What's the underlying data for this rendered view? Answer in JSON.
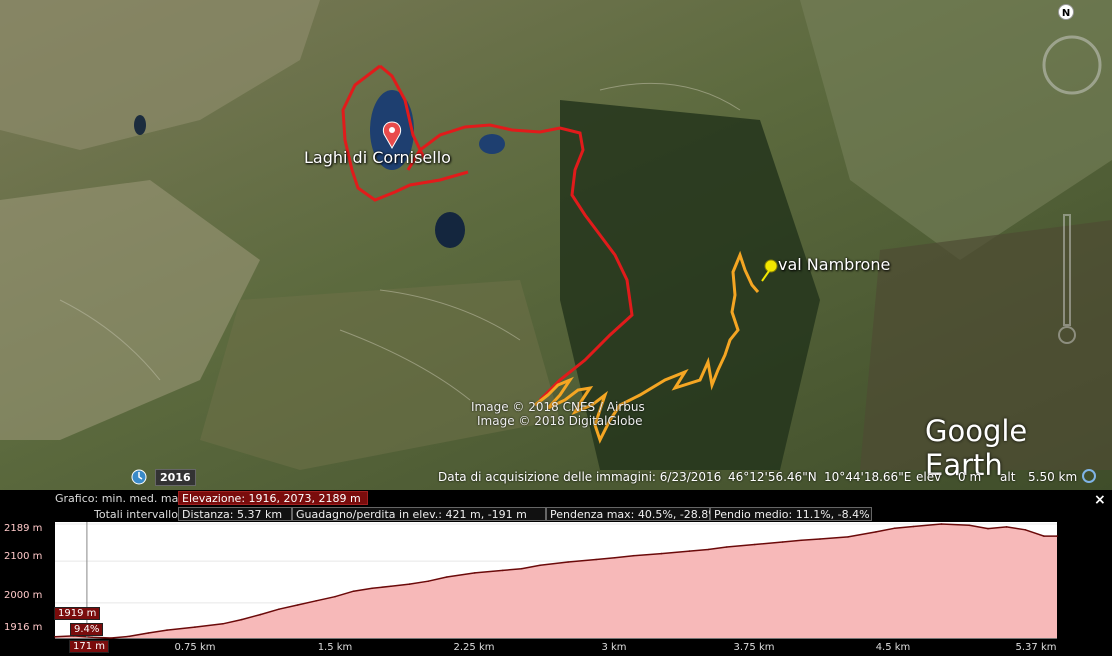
{
  "map": {
    "place_labels": {
      "lakes": "Laghi di Cornisello",
      "valley": "val Nambrone"
    },
    "credits": {
      "line1": "Image © 2018 CNES / Airbus",
      "line2": "Image © 2018 DigitalGlobe"
    },
    "brand": "Google Earth",
    "compass_letter": "N",
    "year_badge": "2016",
    "status": {
      "acquisition": "Data di acquisizione delle immagini: 6/23/2016",
      "lat": "46°12'56.46\"N",
      "lon": "10°44'18.66\"E",
      "elev_label": "elev",
      "elev_value": "0 m",
      "alt_label": "alt",
      "alt_value": "5.50 km"
    },
    "colors": {
      "route_red": "#e11b1b",
      "route_orange": "#f5a623",
      "pin_red": "#e94b4b",
      "pin_yellow": "#f2e600"
    }
  },
  "profile": {
    "row1_label": "Grafico: min. med. max",
    "elevation": "Elevazione: 1916, 2073, 2189 m",
    "row2_label": "Totali intervallo:",
    "distance": "Distanza: 5.37 km",
    "gain_loss": "Guadagno/perdita in elev.: 421 m, -191 m",
    "max_slope": "Pendenza max: 40.5%, -28.8%",
    "avg_slope": "Pendio medio: 11.1%, -8.4%",
    "close_label": "×",
    "cursor": {
      "elev": "1919 m",
      "slope": "9.4%",
      "dist": "171 m"
    },
    "fill_color": "#f7b9b9",
    "line_color": "#6b0a0a"
  },
  "chart_data": {
    "type": "area",
    "xlabel": "",
    "ylabel": "",
    "x_ticks": [
      "0.75 km",
      "1.5 km",
      "2.25 km",
      "3 km",
      "3.75 km",
      "4.5 km",
      "5.37 km"
    ],
    "y_ticks": [
      "2189 m",
      "2100 m",
      "2000 m",
      "1916 m"
    ],
    "ylim": [
      1916,
      2189
    ],
    "xlim": [
      0,
      5.37
    ],
    "series": [
      {
        "x": [
          0,
          0.1,
          0.2,
          0.3,
          0.4,
          0.5,
          0.6,
          0.75,
          0.9,
          1.0,
          1.1,
          1.2,
          1.3,
          1.4,
          1.5,
          1.6,
          1.7,
          1.8,
          1.9,
          2.0,
          2.1,
          2.25,
          2.4,
          2.5,
          2.6,
          2.75,
          2.9,
          3.0,
          3.1,
          3.25,
          3.4,
          3.5,
          3.6,
          3.75,
          3.9,
          4.0,
          4.1,
          4.25,
          4.4,
          4.5,
          4.6,
          4.75,
          4.9,
          5.0,
          5.1,
          5.2,
          5.3,
          5.37
        ],
        "y": [
          1919,
          1921,
          1918,
          1916,
          1920,
          1928,
          1935,
          1942,
          1950,
          1960,
          1972,
          1985,
          1995,
          2005,
          2015,
          2028,
          2035,
          2040,
          2045,
          2052,
          2062,
          2072,
          2078,
          2082,
          2090,
          2098,
          2104,
          2108,
          2113,
          2118,
          2124,
          2128,
          2134,
          2140,
          2146,
          2150,
          2153,
          2158,
          2170,
          2179,
          2183,
          2189,
          2186,
          2178,
          2182,
          2175,
          2160,
          2160
        ]
      }
    ]
  }
}
